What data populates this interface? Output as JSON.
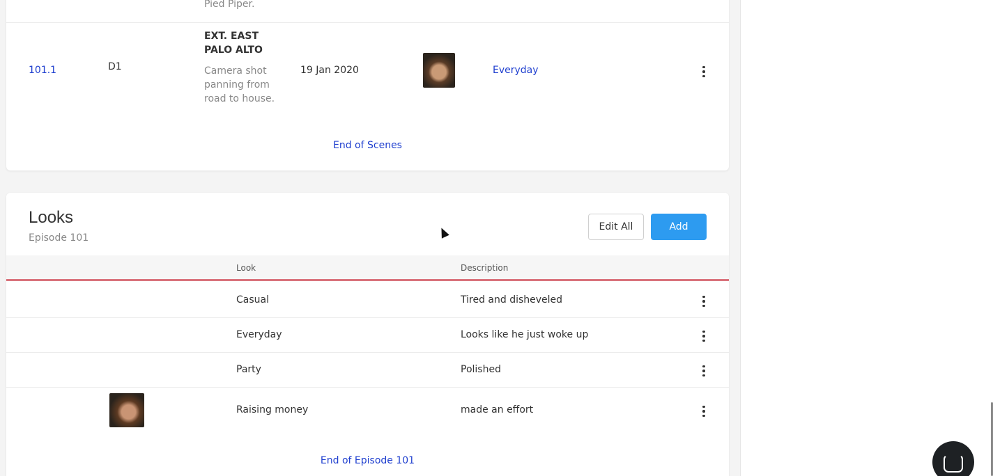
{
  "scenes": {
    "previous_desc_tail": "Pied Piper.",
    "row": {
      "number": "101.1",
      "day": "D1",
      "heading": "EXT. EAST PALO ALTO",
      "description": "Camera shot panning from road to house.",
      "date": "19 Jan 2020",
      "look": "Everyday"
    },
    "end_label": "End of Scenes"
  },
  "looks": {
    "title": "Looks",
    "subtitle": "Episode 101",
    "edit_all_label": "Edit All",
    "add_label": "Add",
    "columns": {
      "look": "Look",
      "description": "Description"
    },
    "rows": [
      {
        "look": "Casual",
        "description": "Tired and disheveled"
      },
      {
        "look": "Everyday",
        "description": "Looks like he just woke up"
      },
      {
        "look": "Party",
        "description": "Polished"
      },
      {
        "look": "Raising money",
        "description": "made an effort"
      }
    ],
    "end_label": "End of Episode 101"
  },
  "colors": {
    "link": "#1f3fcf",
    "primary_button": "#2d9bf0",
    "header_underline": "#d9727b"
  },
  "icons": [
    "kebab-menu-icon",
    "chat-icon",
    "cursor-icon"
  ]
}
